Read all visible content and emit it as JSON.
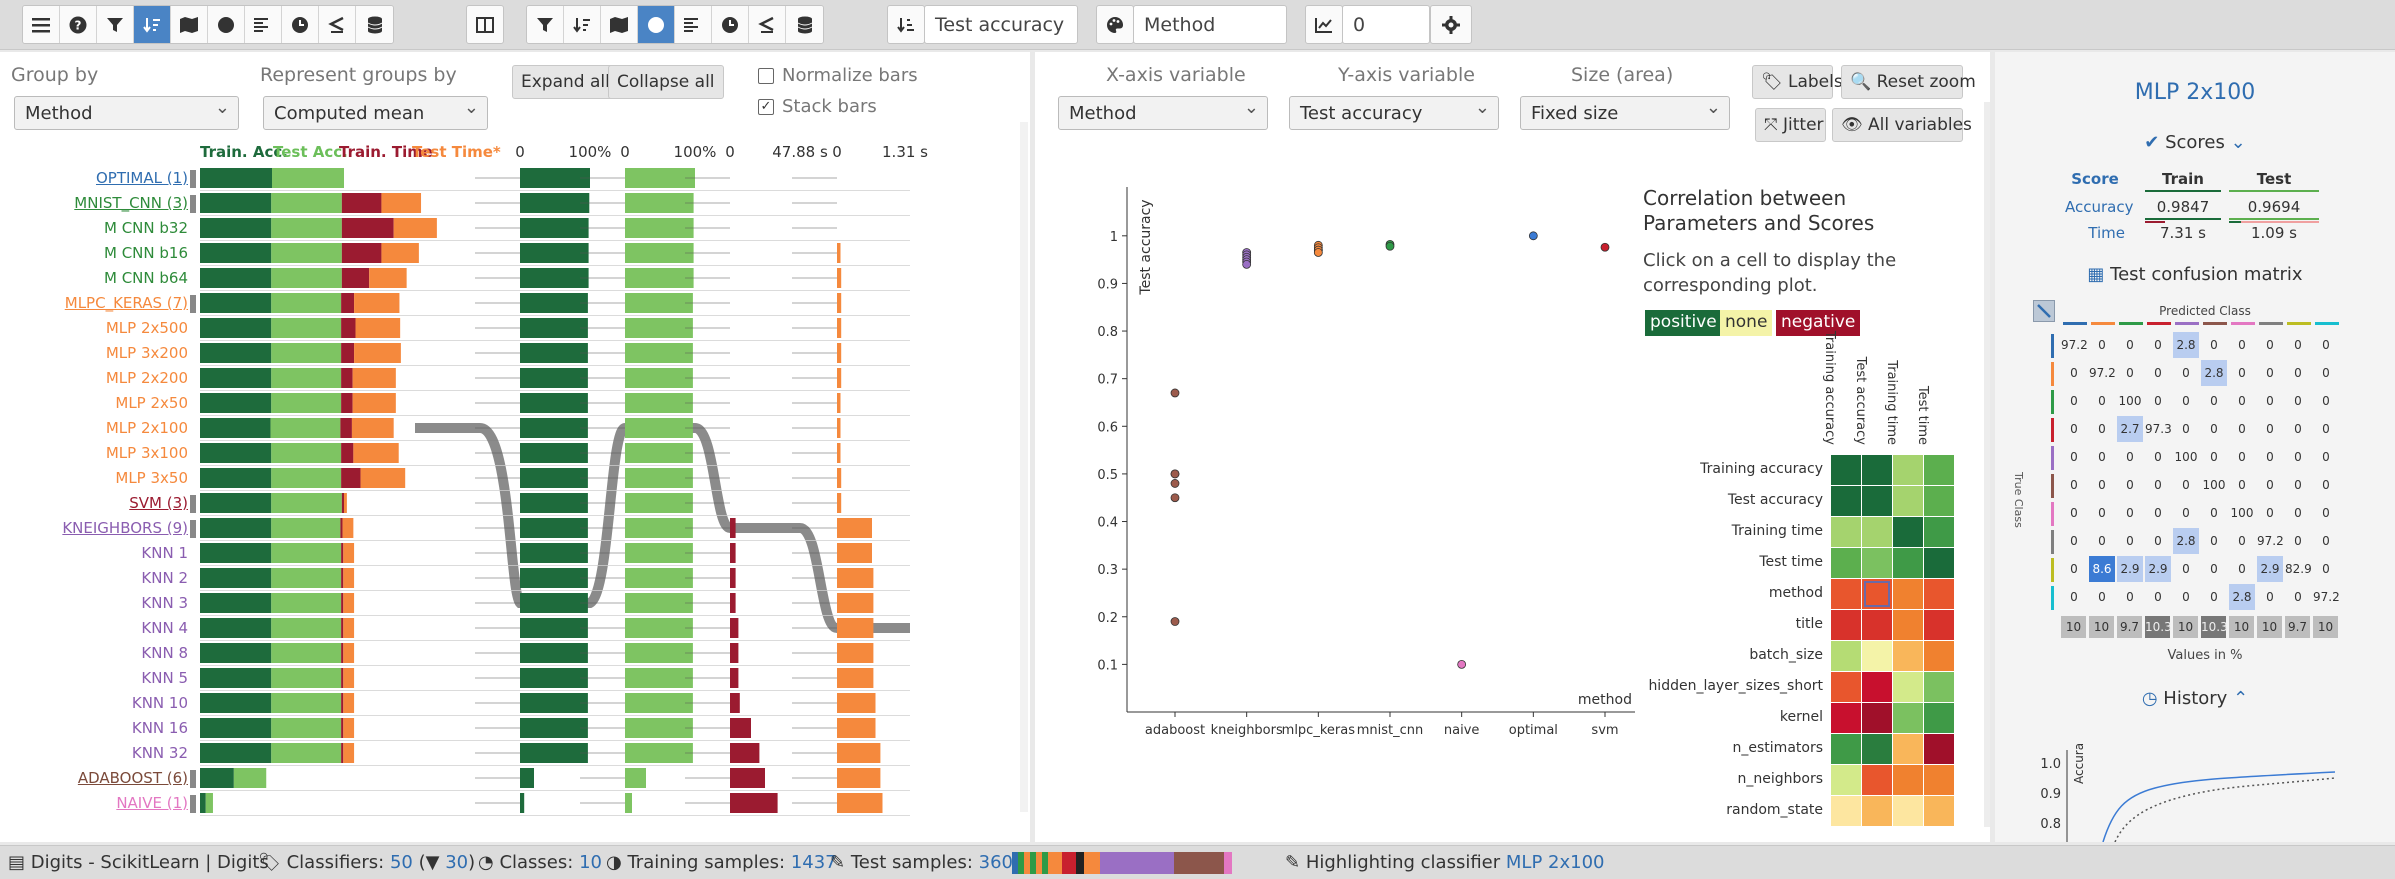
{
  "toolbar": {
    "sort_field": "Test accuracy",
    "color_field": "Method",
    "count_field": "0"
  },
  "left": {
    "group_by_label": "Group by",
    "group_by_value": "Method",
    "represent_label": "Represent groups by",
    "represent_value": "Computed mean",
    "expand_label": "Expand all",
    "collapse_label": "Collapse all",
    "normalize_label": "Normalize bars",
    "stack_label": "Stack bars",
    "col_headers": [
      {
        "text": "Train. Acc.",
        "color": "#1e6b3c"
      },
      {
        "text": "Test Acc.",
        "color": "#6cbf5a"
      },
      {
        "text": "Train. Time",
        "color": "#9b1b30"
      },
      {
        "text": "Test Time*",
        "color": "#f5893d"
      }
    ],
    "axis_labels": [
      {
        "x": 520,
        "text": "0"
      },
      {
        "x": 590,
        "text": "100%"
      },
      {
        "x": 625,
        "text": "0"
      },
      {
        "x": 695,
        "text": "100%"
      },
      {
        "x": 730,
        "text": "0"
      },
      {
        "x": 800,
        "text": "47.88 s"
      },
      {
        "x": 837,
        "text": "0"
      },
      {
        "x": 905,
        "text": "1.31 s"
      }
    ],
    "rows": [
      {
        "label": "OPTIMAL (1)",
        "color": "#2f6db0",
        "group": true,
        "ta": 1.0,
        "te": 1.0,
        "tt": 0,
        "et": 0
      },
      {
        "label": "MNIST_CNN (3)",
        "color": "#2e8b3a",
        "group": true,
        "ta": 0.99,
        "te": 0.98,
        "tt": 0.55,
        "et": 0.55
      },
      {
        "label": "M CNN b32",
        "color": "#2e8b3a",
        "group": false,
        "ta": 0.99,
        "te": 0.98,
        "tt": 0.72,
        "et": 0.6
      },
      {
        "label": "M CNN b16",
        "color": "#2e8b3a",
        "group": false,
        "ta": 0.99,
        "te": 0.98,
        "tt": 0.55,
        "et": 0.52
      },
      {
        "label": "M CNN b64",
        "color": "#2e8b3a",
        "group": false,
        "ta": 0.99,
        "te": 0.98,
        "tt": 0.38,
        "et": 0.52
      },
      {
        "label": "MLPC_KERAS (7)",
        "color": "#f5893d",
        "group": true,
        "ta": 0.99,
        "te": 0.97,
        "tt": 0.18,
        "et": 0.63
      },
      {
        "label": "MLP 2x500",
        "color": "#f5893d",
        "group": false,
        "ta": 0.99,
        "te": 0.97,
        "tt": 0.2,
        "et": 0.62
      },
      {
        "label": "MLP 3x200",
        "color": "#f5893d",
        "group": false,
        "ta": 0.99,
        "te": 0.97,
        "tt": 0.18,
        "et": 0.65
      },
      {
        "label": "MLP 2x200",
        "color": "#f5893d",
        "group": false,
        "ta": 0.99,
        "te": 0.97,
        "tt": 0.16,
        "et": 0.6
      },
      {
        "label": "MLP 2x50",
        "color": "#f5893d",
        "group": false,
        "ta": 0.99,
        "te": 0.97,
        "tt": 0.16,
        "et": 0.6
      },
      {
        "label": "MLP 2x100",
        "color": "#f5893d",
        "group": false,
        "highlight": true,
        "ta": 0.98,
        "te": 0.97,
        "tt": 0.16,
        "et": 0.58
      },
      {
        "label": "MLP 3x100",
        "color": "#f5893d",
        "group": false,
        "ta": 0.99,
        "te": 0.97,
        "tt": 0.17,
        "et": 0.63
      },
      {
        "label": "MLP 3x50",
        "color": "#f5893d",
        "group": false,
        "ta": 0.99,
        "te": 0.97,
        "tt": 0.27,
        "et": 0.62
      },
      {
        "label": "SVM (3)",
        "color": "#9b1b30",
        "group": true,
        "ta": 0.99,
        "te": 0.98,
        "tt": 0.03,
        "et": 0.04
      },
      {
        "label": "KNEIGHBORS (9)",
        "color": "#8a5db0",
        "group": true,
        "ta": 0.99,
        "te": 0.96,
        "tt": 0.03,
        "et": 0.15
      },
      {
        "label": "KNN 1",
        "color": "#8a5db0",
        "group": false,
        "ta": 0.99,
        "te": 0.97,
        "tt": 0.03,
        "et": 0.15
      },
      {
        "label": "KNN 2",
        "color": "#8a5db0",
        "group": false,
        "ta": 0.99,
        "te": 0.97,
        "tt": 0.03,
        "et": 0.15
      },
      {
        "label": "KNN 3",
        "color": "#8a5db0",
        "group": false,
        "ta": 0.99,
        "te": 0.97,
        "tt": 0.03,
        "et": 0.15
      },
      {
        "label": "KNN 4",
        "color": "#8a5db0",
        "group": false,
        "ta": 0.99,
        "te": 0.97,
        "tt": 0.03,
        "et": 0.15
      },
      {
        "label": "KNN 8",
        "color": "#8a5db0",
        "group": false,
        "ta": 0.99,
        "te": 0.97,
        "tt": 0.03,
        "et": 0.15
      },
      {
        "label": "KNN 5",
        "color": "#8a5db0",
        "group": false,
        "ta": 0.99,
        "te": 0.97,
        "tt": 0.03,
        "et": 0.15
      },
      {
        "label": "KNN 10",
        "color": "#8a5db0",
        "group": false,
        "ta": 0.99,
        "te": 0.97,
        "tt": 0.03,
        "et": 0.15
      },
      {
        "label": "KNN 16",
        "color": "#8a5db0",
        "group": false,
        "ta": 0.99,
        "te": 0.97,
        "tt": 0.03,
        "et": 0.15
      },
      {
        "label": "KNN 32",
        "color": "#8a5db0",
        "group": false,
        "ta": 0.99,
        "te": 0.97,
        "tt": 0.03,
        "et": 0.15
      },
      {
        "label": "ADABOOST (6)",
        "color": "#7b4a3a",
        "group": true,
        "ta": 0.47,
        "te": 0.45,
        "tt": 0,
        "et": 0
      },
      {
        "label": "NAIVE (1)",
        "color": "#e377c2",
        "group": true,
        "ta": 0.08,
        "te": 0.1,
        "tt": 0,
        "et": 0
      }
    ],
    "rank_bars": {
      "acc": [
        1.0,
        0.99,
        0.98,
        0.98,
        0.98,
        0.97,
        0.97,
        0.97,
        0.97,
        0.97,
        0.97,
        0.97,
        0.97,
        0.97,
        0.97,
        0.97,
        0.97,
        0.97,
        0.97,
        0.97,
        0.97,
        0.97,
        0.97,
        0.97,
        0.2,
        0.06
      ],
      "test": [
        1.0,
        0.98,
        0.98,
        0.98,
        0.98,
        0.97,
        0.97,
        0.97,
        0.97,
        0.97,
        0.97,
        0.97,
        0.97,
        0.97,
        0.97,
        0.97,
        0.97,
        0.97,
        0.97,
        0.97,
        0.97,
        0.97,
        0.97,
        0.97,
        0.3,
        0.1
      ],
      "ttime": [
        0,
        0,
        0,
        0,
        0,
        0,
        0,
        0,
        0,
        0,
        0,
        0,
        0,
        0,
        0.08,
        0.08,
        0.08,
        0.08,
        0.12,
        0.12,
        0.12,
        0.14,
        0.3,
        0.42,
        0.5,
        0.68
      ],
      "etime": [
        0,
        0,
        0,
        0.05,
        0.06,
        0.06,
        0.06,
        0.06,
        0.06,
        0.05,
        0.05,
        0.05,
        0.06,
        0.06,
        0.5,
        0.5,
        0.52,
        0.52,
        0.52,
        0.52,
        0.52,
        0.55,
        0.55,
        0.62,
        0.62,
        0.65
      ]
    }
  },
  "mid": {
    "x_label": "X-axis variable",
    "x_value": "Method",
    "y_label": "Y-axis variable",
    "y_value": "Test accuracy",
    "size_label": "Size (area)",
    "size_value": "Fixed size",
    "labels_btn": "Labels",
    "reset_btn": "Reset zoom",
    "jitter_btn": "Jitter",
    "allvars_btn": "All variables",
    "corr_title": "Correlation between Parameters and Scores",
    "corr_hint": "Click on a cell to display the corresponding plot.",
    "legend_positive": "positive",
    "legend_none": "none",
    "legend_negative": "negative",
    "corr_cols": [
      "Training accuracy",
      "Test accuracy",
      "Training time",
      "Test time"
    ],
    "corr_rows": [
      "Training accuracy",
      "Test accuracy",
      "Training time",
      "Test time",
      "method",
      "title",
      "batch_size",
      "hidden_layer_sizes_short",
      "kernel",
      "n_estimators",
      "n_neighbors",
      "random_state"
    ],
    "corr_colors": [
      [
        "#1a6b3a",
        "#1a6b3a",
        "#a5d36e",
        "#5caf4e"
      ],
      [
        "#1a6b3a",
        "#1a6b3a",
        "#a5d36e",
        "#5caf4e"
      ],
      [
        "#a5d36e",
        "#a5d36e",
        "#1a6b3a",
        "#3f9a47"
      ],
      [
        "#5caf4e",
        "#7bc160",
        "#3f9a47",
        "#1a6b3a"
      ],
      [
        "#e8562d",
        "#e8562d",
        "#f0812f",
        "#e8562d"
      ],
      [
        "#d8322b",
        "#d8322b",
        "#f0812f",
        "#d8322b"
      ],
      [
        "#b5dc74",
        "#f4f3a8",
        "#f9b65a",
        "#f0812f"
      ],
      [
        "#e8562d",
        "#c8102e",
        "#d3ea8a",
        "#7bc160"
      ],
      [
        "#c8102e",
        "#a0102a",
        "#7bc160",
        "#3f9a47"
      ],
      [
        "#3f9a47",
        "#2a7d3e",
        "#f9b65a",
        "#a0102a"
      ],
      [
        "#d3ea8a",
        "#e8562d",
        "#f0812f",
        "#f0812f"
      ],
      [
        "#fde6a0",
        "#f9b65a",
        "#fde6a0",
        "#f9b65a"
      ]
    ],
    "y_axis_title": "Test accuracy",
    "x_axis_title": "method"
  },
  "chart_data": {
    "type": "scatter",
    "title": "",
    "xlabel": "method",
    "ylabel": "Test accuracy",
    "ylim": [
      0.0,
      1.05
    ],
    "yticks": [
      0.1,
      0.2,
      0.3,
      0.4,
      0.5,
      0.6,
      0.7,
      0.8,
      0.9,
      1
    ],
    "categories": [
      "adaboost",
      "kneighbors",
      "mlpc_keras",
      "mnist_cnn",
      "naive",
      "optimal",
      "svm"
    ],
    "series": [
      {
        "category": "adaboost",
        "color": "#9c5b4c",
        "values": [
          0.67,
          0.5,
          0.5,
          0.48,
          0.45,
          0.19
        ]
      },
      {
        "category": "kneighbors",
        "color": "#9a6fc4",
        "values": [
          0.965,
          0.96,
          0.955,
          0.95,
          0.945,
          0.94
        ]
      },
      {
        "category": "mlpc_keras",
        "color": "#f5893d",
        "values": [
          0.98,
          0.975,
          0.97,
          0.97,
          0.965
        ]
      },
      {
        "category": "mnist_cnn",
        "color": "#2e9a47",
        "values": [
          0.982,
          0.978
        ]
      },
      {
        "category": "naive",
        "color": "#e377c2",
        "values": [
          0.1
        ]
      },
      {
        "category": "optimal",
        "color": "#3b7bd4",
        "values": [
          1.0
        ]
      },
      {
        "category": "svm",
        "color": "#c8202e",
        "values": [
          0.976
        ]
      }
    ]
  },
  "right": {
    "title": "MLP 2x100",
    "scores_label": "Scores",
    "score_header": "Score",
    "train_header": "Train",
    "test_header": "Test",
    "acc_label": "Accuracy",
    "acc_train": "0.9847",
    "acc_test": "0.9694",
    "time_label": "Time",
    "time_train": "7.31 s",
    "time_test": "1.09 s",
    "confusion_label": "Test confusion matrix",
    "predicted_label": "Predicted Class",
    "true_label": "True Class",
    "values_label": "Values in %",
    "class_colors": [
      "#2f6db0",
      "#f5893d",
      "#2e9a47",
      "#c8202e",
      "#9a6fc4",
      "#8c564b",
      "#e377c2",
      "#7f7f7f",
      "#bcbd22",
      "#17becf"
    ],
    "matrix": [
      [
        "97.2",
        "0",
        "0",
        "0",
        "2.8",
        "0",
        "0",
        "0",
        "0",
        "0"
      ],
      [
        "0",
        "97.2",
        "0",
        "0",
        "0",
        "2.8",
        "0",
        "0",
        "0",
        "0"
      ],
      [
        "0",
        "0",
        "100",
        "0",
        "0",
        "0",
        "0",
        "0",
        "0",
        "0"
      ],
      [
        "0",
        "0",
        "2.7",
        "97.3",
        "0",
        "0",
        "0",
        "0",
        "0",
        "0"
      ],
      [
        "0",
        "0",
        "0",
        "0",
        "100",
        "0",
        "0",
        "0",
        "0",
        "0"
      ],
      [
        "0",
        "0",
        "0",
        "0",
        "0",
        "100",
        "0",
        "0",
        "0",
        "0"
      ],
      [
        "0",
        "0",
        "0",
        "0",
        "0",
        "0",
        "100",
        "0",
        "0",
        "0"
      ],
      [
        "0",
        "0",
        "0",
        "0",
        "2.8",
        "0",
        "0",
        "97.2",
        "0",
        "0"
      ],
      [
        "0",
        "8.6",
        "2.9",
        "2.9",
        "0",
        "0",
        "0",
        "2.9",
        "82.9",
        "0"
      ],
      [
        "0",
        "0",
        "0",
        "0",
        "0",
        "0",
        "2.8",
        "0",
        "0",
        "97.2"
      ]
    ],
    "totals": [
      "10",
      "10",
      "9.7",
      "10.3",
      "10",
      "10.3",
      "10",
      "10",
      "9.7",
      "10"
    ],
    "history_label": "History",
    "hist_ylabel": "Accuracy",
    "hist_ticks": [
      "1.0",
      "0.9",
      "0.8"
    ]
  },
  "status": {
    "dataset": "Digits - ScikitLearn | Digits",
    "classifiers_label": "Classifiers:",
    "classifiers_value": "50",
    "filtered_value": "30",
    "classes_label": "Classes:",
    "classes_value": "10",
    "train_label": "Training samples:",
    "train_value": "1437",
    "test_label": "Test samples:",
    "test_value": "360",
    "highlight_label": "Highlighting classifier",
    "highlight_value": "MLP 2x100",
    "strip": [
      {
        "w": 6,
        "c": "#2f6db0"
      },
      {
        "w": 6,
        "c": "#2e9a47"
      },
      {
        "w": 6,
        "c": "#f5893d"
      },
      {
        "w": 6,
        "c": "#2e9a47"
      },
      {
        "w": 6,
        "c": "#f5893d"
      },
      {
        "w": 6,
        "c": "#2e9a47"
      },
      {
        "w": 14,
        "c": "#f5893d"
      },
      {
        "w": 14,
        "c": "#c8202e"
      },
      {
        "w": 8,
        "c": "#222222"
      },
      {
        "w": 16,
        "c": "#f5893d"
      },
      {
        "w": 74,
        "c": "#9a6fc4"
      },
      {
        "w": 50,
        "c": "#8c564b"
      },
      {
        "w": 8,
        "c": "#e377c2"
      }
    ]
  }
}
